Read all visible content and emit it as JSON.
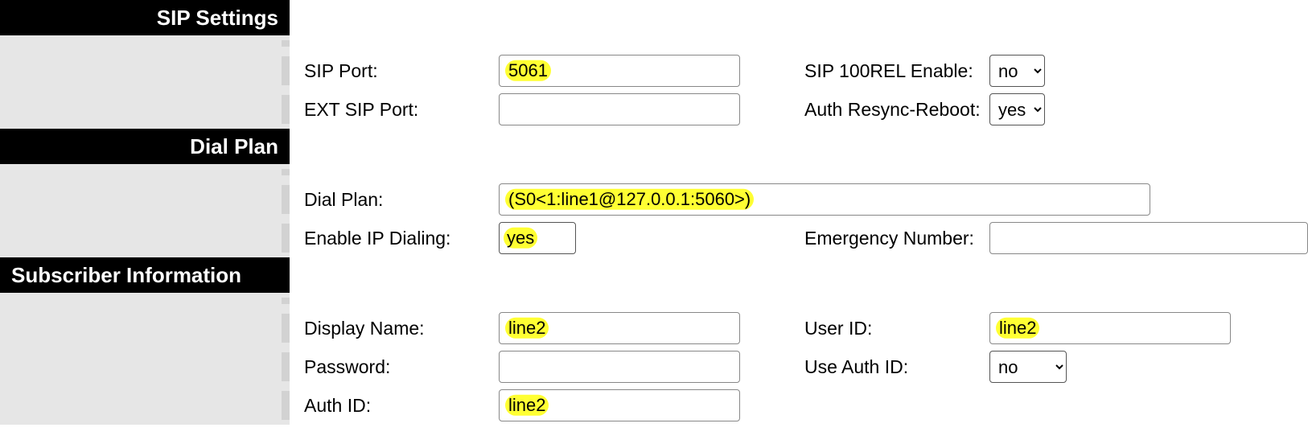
{
  "sections": {
    "sip_settings": "SIP Settings",
    "dial_plan": "Dial Plan",
    "subscriber_info": "Subscriber Information"
  },
  "sip": {
    "sip_port_label": "SIP Port:",
    "sip_port_value": "5061",
    "ext_sip_port_label": "EXT SIP Port:",
    "ext_sip_port_value": "",
    "sip_100rel_label": "SIP 100REL Enable:",
    "sip_100rel_value": "no",
    "auth_resync_label": "Auth Resync-Reboot:",
    "auth_resync_value": "yes"
  },
  "dialplan": {
    "dial_plan_label": "Dial Plan:",
    "dial_plan_value": "(S0<1:line1@127.0.0.1:5060>)",
    "enable_ip_dial_label": "Enable IP Dialing:",
    "enable_ip_dial_value": "yes",
    "emergency_label": "Emergency Number:",
    "emergency_value": ""
  },
  "subscriber": {
    "display_name_label": "Display Name:",
    "display_name_value": "line2",
    "password_label": "Password:",
    "password_value": "",
    "auth_id_label": "Auth ID:",
    "auth_id_value": "line2",
    "user_id_label": "User ID:",
    "user_id_value": "line2",
    "use_auth_id_label": "Use Auth ID:",
    "use_auth_id_value": "no"
  },
  "options": {
    "yes": "yes",
    "no": "no"
  }
}
